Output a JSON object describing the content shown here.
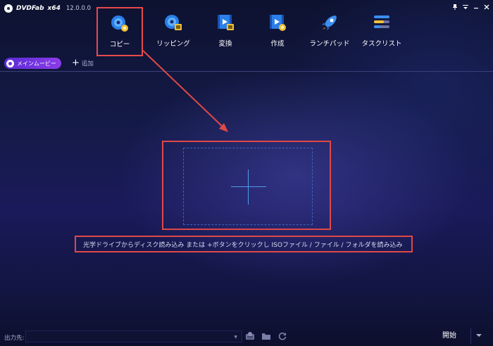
{
  "app": {
    "name": "DVDFab",
    "arch": "x64",
    "version": "12.0.0.0"
  },
  "window_controls": [
    "pin-icon",
    "menu-icon",
    "minimize-icon",
    "close-icon"
  ],
  "modules": [
    {
      "label": "コピー",
      "icon": "disc-copy-icon",
      "active": true
    },
    {
      "label": "リッピング",
      "icon": "disc-ripper-icon",
      "active": false
    },
    {
      "label": "変換",
      "icon": "video-converter-icon",
      "active": false
    },
    {
      "label": "作成",
      "icon": "video-creator-icon",
      "active": false
    },
    {
      "label": "ランチパッド",
      "icon": "rocket-icon",
      "active": false
    },
    {
      "label": "タスクリスト",
      "icon": "task-list-icon",
      "active": false
    }
  ],
  "tabs": {
    "main_label": "メインムービー",
    "add_label": "追加"
  },
  "drop_zone": {
    "hint": "光学ドライブからディスク読み込み または +ボタンをクリックし ISOファイル / ファイル / フォルダを読み込み"
  },
  "footer": {
    "output_label": "出力先:",
    "output_value": "",
    "icons": [
      "iso-icon",
      "folder-icon",
      "refresh-icon"
    ],
    "start_label": "開始"
  },
  "colors": {
    "highlight_red": "#e04848",
    "accent_purple": "#7a34e0",
    "plus_blue": "#4f9be8"
  }
}
